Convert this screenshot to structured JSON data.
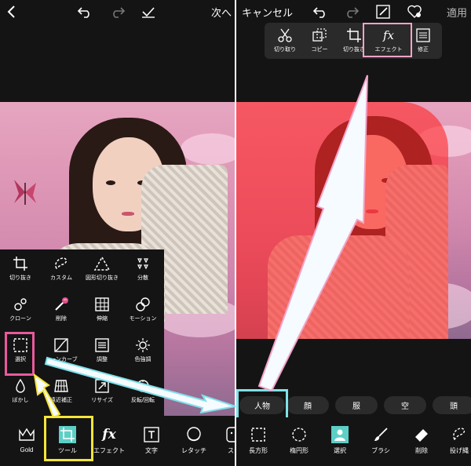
{
  "left": {
    "topbar": {
      "next_label": "次へ"
    },
    "tools": [
      {
        "label": "切り抜き",
        "icon": "crop-icon"
      },
      {
        "label": "カスタム",
        "icon": "lasso-icon"
      },
      {
        "label": "図形切り抜き",
        "icon": "shape-crop-icon"
      },
      {
        "label": "分散",
        "icon": "dispersion-icon"
      },
      {
        "label": "クローン",
        "icon": "clone-icon"
      },
      {
        "label": "削除",
        "icon": "magic-remove-icon"
      },
      {
        "label": "伸縮",
        "icon": "stretch-icon"
      },
      {
        "label": "モーション",
        "icon": "motion-icon"
      },
      {
        "label": "選択",
        "icon": "select-icon"
      },
      {
        "label": "トーンカーブ",
        "icon": "curves-icon"
      },
      {
        "label": "調整",
        "icon": "adjust-icon"
      },
      {
        "label": "色強調",
        "icon": "brightness-icon"
      },
      {
        "label": "ぼかし",
        "icon": "blur-drop-icon"
      },
      {
        "label": "遠近補正",
        "icon": "perspective-icon"
      },
      {
        "label": "リサイズ",
        "icon": "resize-icon"
      },
      {
        "label": "反転/回転",
        "icon": "flip-rotate-icon"
      }
    ],
    "bottom": [
      {
        "label": "Gold",
        "icon": "crown-icon"
      },
      {
        "label": "ツール",
        "icon": "crop-tool-icon"
      },
      {
        "label": "エフェクト",
        "icon": "fx-icon"
      },
      {
        "label": "文字",
        "icon": "text-icon"
      },
      {
        "label": "レタッチ",
        "icon": "retouch-icon"
      },
      {
        "label": "ステ",
        "icon": "sticker-icon"
      }
    ]
  },
  "right": {
    "topbar": {
      "cancel_label": "キャンセル",
      "apply_label": "適用"
    },
    "popup": [
      {
        "label": "切り取り",
        "icon": "cut-icon"
      },
      {
        "label": "コピー",
        "icon": "copy-icon"
      },
      {
        "label": "切り抜き",
        "icon": "crop-icon"
      },
      {
        "label": "エフェクト",
        "icon": "fx-icon"
      },
      {
        "label": "修正",
        "icon": "edit-icon"
      }
    ],
    "categories": [
      "人物",
      "顔",
      "服",
      "空",
      "頭"
    ],
    "bottom": [
      {
        "label": "長方形",
        "icon": "rect-select-icon"
      },
      {
        "label": "楕円形",
        "icon": "ellipse-select-icon"
      },
      {
        "label": "選択",
        "icon": "person-select-icon"
      },
      {
        "label": "ブラシ",
        "icon": "brush-icon"
      },
      {
        "label": "削除",
        "icon": "eraser-icon"
      },
      {
        "label": "投げ縄",
        "icon": "lasso-icon"
      }
    ]
  },
  "colors": {
    "highlight_pink": "#e85a9c",
    "highlight_yellow": "#f5e437",
    "highlight_cyan": "#7fe0e8",
    "selected_tool": "#5ccfc6",
    "mask_red": "#ff2828"
  }
}
